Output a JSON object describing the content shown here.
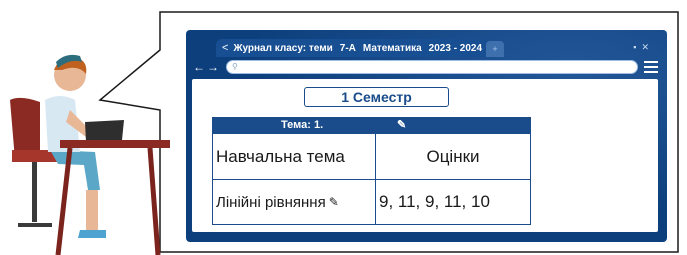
{
  "tab": {
    "back_label": "<",
    "segments": [
      "Журнал класу: теми",
      "7-А",
      "Математика",
      "2023 - 2024"
    ],
    "new_tab_label": "+"
  },
  "window_controls": [
    "▪",
    "✕"
  ],
  "nav": {
    "back": "←",
    "forward": "→",
    "address_value": ""
  },
  "semester_label": "1 Семестр",
  "table": {
    "topic_header": "Тема:  1.",
    "columns": [
      "Навчальна тема",
      "Оцінки"
    ],
    "rows": [
      {
        "topic": "Лінійні рівняння",
        "grades": "9,  11,  9,  11,  10"
      }
    ]
  },
  "colors": {
    "frame": "#0e3f7d",
    "accent": "#1a4c8b"
  },
  "icons": [
    "search-icon",
    "menu-icon",
    "pencil-icon"
  ]
}
